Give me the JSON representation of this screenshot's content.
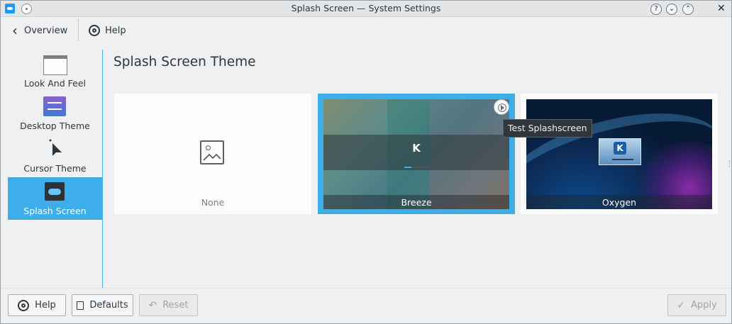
{
  "window": {
    "title": "Splash Screen  — System Settings",
    "title_buttons": [
      "?",
      "⌄",
      "⌃",
      "✕"
    ]
  },
  "toolbar": {
    "overview_label": "Overview",
    "help_label": "Help"
  },
  "sidebar": {
    "items": [
      {
        "label": "Look And Feel",
        "icon": "look-and-feel-icon",
        "selected": false
      },
      {
        "label": "Desktop Theme",
        "icon": "desktop-theme-icon",
        "selected": false
      },
      {
        "label": "Cursor Theme",
        "icon": "cursor-icon",
        "selected": false
      },
      {
        "label": "Splash Screen",
        "icon": "splash-screen-icon",
        "selected": true
      }
    ]
  },
  "main": {
    "title": "Splash Screen Theme",
    "themes": [
      {
        "label": "None",
        "selected": false
      },
      {
        "label": "Breeze",
        "selected": true
      },
      {
        "label": "Oxygen",
        "selected": false
      }
    ],
    "tooltip": "Test Splashscreen"
  },
  "footer": {
    "help_label": "Help",
    "defaults_label": "Defaults",
    "reset_label": "Reset",
    "apply_label": "Apply"
  },
  "colors": {
    "accent": "#3daee9",
    "window_bg": "#eff0f1",
    "text": "#31363b",
    "tooltip_bg": "#31363b"
  }
}
